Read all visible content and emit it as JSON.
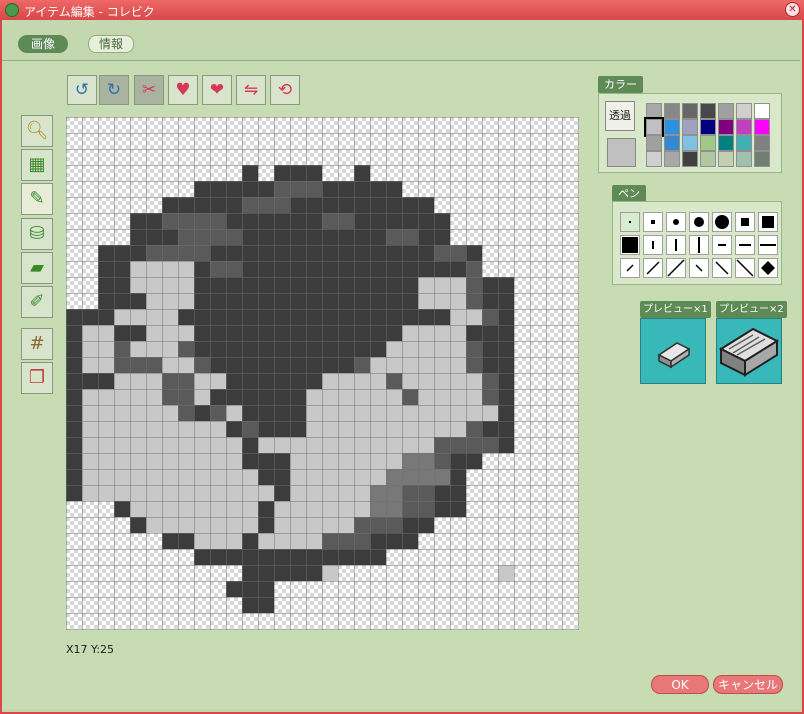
{
  "window": {
    "title": "アイテム編集 - コレビク"
  },
  "tabs": [
    {
      "label": "画像",
      "active": true
    },
    {
      "label": "情報",
      "active": false
    }
  ],
  "toolbar_top": [
    {
      "icon": "undo-icon"
    },
    {
      "icon": "redo-icon"
    },
    {
      "icon": "cut-icon"
    },
    {
      "icon": "clear-icon"
    },
    {
      "icon": "copy-icon"
    },
    {
      "icon": "flip-icon"
    },
    {
      "icon": "rotate-icon"
    }
  ],
  "toolbar_left": [
    {
      "icon": "zoom-icon"
    },
    {
      "icon": "select-icon"
    },
    {
      "icon": "pencil-icon",
      "active": true
    },
    {
      "icon": "fill-bucket-icon"
    },
    {
      "icon": "eraser-icon"
    },
    {
      "icon": "eyedropper-icon"
    },
    {
      "icon": "grid-icon"
    },
    {
      "icon": "layers-icon"
    }
  ],
  "canvas": {
    "grid_size": 32,
    "colors": {
      "0": "#c8c8c8",
      "1": "#a0a0a0",
      "2": "#787878",
      "3": "#5a5a5a",
      "4": "#3c3c3c"
    },
    "pixels": [
      "................................",
      "................................",
      "................................",
      "...........4.444..4.............",
      "........4444433344444...........",
      "......44444333444444444.........",
      "....44333344444433444444........",
      "....44433334444444443344........",
      "..444333344444444444444334......",
      "..440000433444444444444443......",
      "..44000044444444444444000344....",
      "..44400044444444444444000344....",
      "4440000444444444444444440034....",
      "4004400044444444444440000444....",
      "4003000344444444444400000344....",
      "4003330034444444443000000344....",
      "4440003300444444000030000034....",
      "4000003304444440000003000034....",
      "4000000343044440000000000004....",
      "4000000000434440000000000344....",
      "4000000000040000000000033334....",
      "40000000000444000000022344......",
      "4000000000004400000022224.......",
      "4000000000000400000223344.......",
      "...4000000004000000223344.......",
      "....4000000040000033344.........",
      "......4400040000333444..........",
      "........444444444444............",
      "...........444440..........0....",
      "..........444...................",
      "...........44...................",
      "................................"
    ]
  },
  "status": {
    "coord": "X17 Y:25"
  },
  "color_section": {
    "title": "カラー",
    "transparent_label": "透過",
    "current_color": "#c0c0c0",
    "palette": [
      "#a8a8a8",
      "#888888",
      "#686868",
      "#484848",
      "#a0a0a0",
      "#d0d0d0",
      "#ffffff",
      "#c0c0c0",
      "#3090e0",
      "#a0a0c0",
      "#000080",
      "#800080",
      "#c040c0",
      "#ff00ff",
      "#a0a0a0",
      "#3888d0",
      "#80c0e0",
      "#a0c888",
      "#008080",
      "#40b0b0",
      "#808080",
      "#d0d0d0",
      "#a8a8a8",
      "#404040",
      "#b0c8a0",
      "#c0d0b0",
      "#a0c0b0",
      "#708070"
    ]
  },
  "pen_section": {
    "title": "ペン"
  },
  "preview": {
    "x1_label": "プレビュー×1",
    "x2_label": "プレビュー×2"
  },
  "buttons": {
    "ok": "OK",
    "cancel": "キャンセル"
  }
}
